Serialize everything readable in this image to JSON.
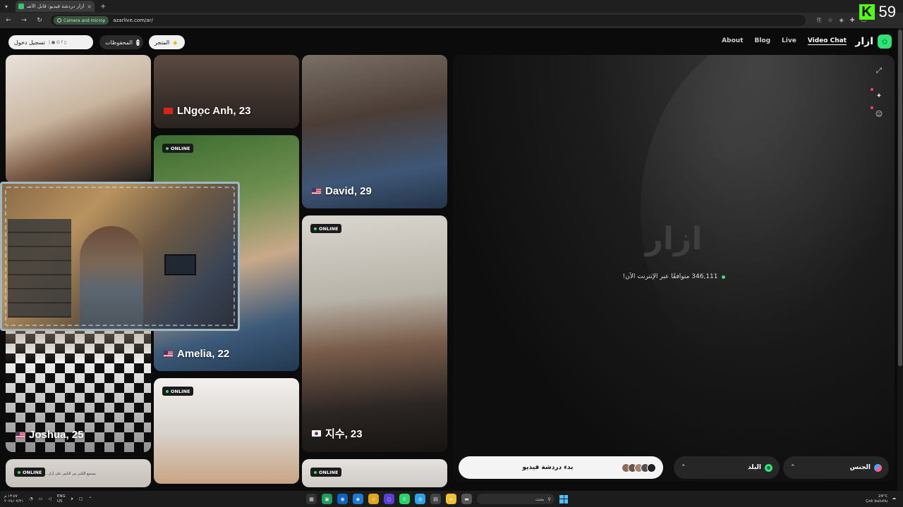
{
  "browser": {
    "tab_title": "أزار دردشة فيديو: قابل الأصدقاء",
    "new_tab": "+",
    "tab_close": "×",
    "permission_chip": "Camera and microp",
    "url": "azarlive.com/ar/"
  },
  "stream": {
    "platform_icon": "K",
    "count": "59"
  },
  "header": {
    "login_label": "تسجيل دخول",
    "saved_label": "المحفوظات",
    "store_label": "المتجر",
    "nav": [
      "About",
      "Blog",
      "Live",
      "Video Chat"
    ],
    "brand": "ازار"
  },
  "cards": [
    {
      "label": "LNgọc Anh, 23",
      "flag": "vn"
    },
    {
      "label": "David, 29",
      "flag": "us"
    },
    {
      "label": "Amelia, 22",
      "flag": "us",
      "badge": "ONLINE"
    },
    {
      "label": "지수, 23",
      "flag": "kr",
      "badge": "ONLINE"
    },
    {
      "label": "Joshua, 25",
      "flag": "us"
    },
    {
      "badge": "ONLINE"
    },
    {
      "badge": "ONLINE",
      "caption": "يستمع الكثير من الناس على أزار..."
    },
    {
      "badge": "ONLINE"
    }
  ],
  "video": {
    "watermark": "ازار",
    "online_status": "346,111 متوافقًا عبر الإنترنت الآن!",
    "start_label": "بدء دردشة فيديو",
    "country_label": "البلد",
    "gender_label": "الجنس"
  },
  "taskbar": {
    "time": "١٣:٥٧ م",
    "date": "٢٠٢٤/٠٧/٢١",
    "lang_top": "ENG",
    "lang_bottom": "US",
    "search_label": "بحث",
    "temp": "24°C",
    "weather": "Çok bulutlu"
  },
  "colors": {
    "accent_green": "#35e07a",
    "online_dot": "#39e07a",
    "kick_green": "#53fc18"
  }
}
